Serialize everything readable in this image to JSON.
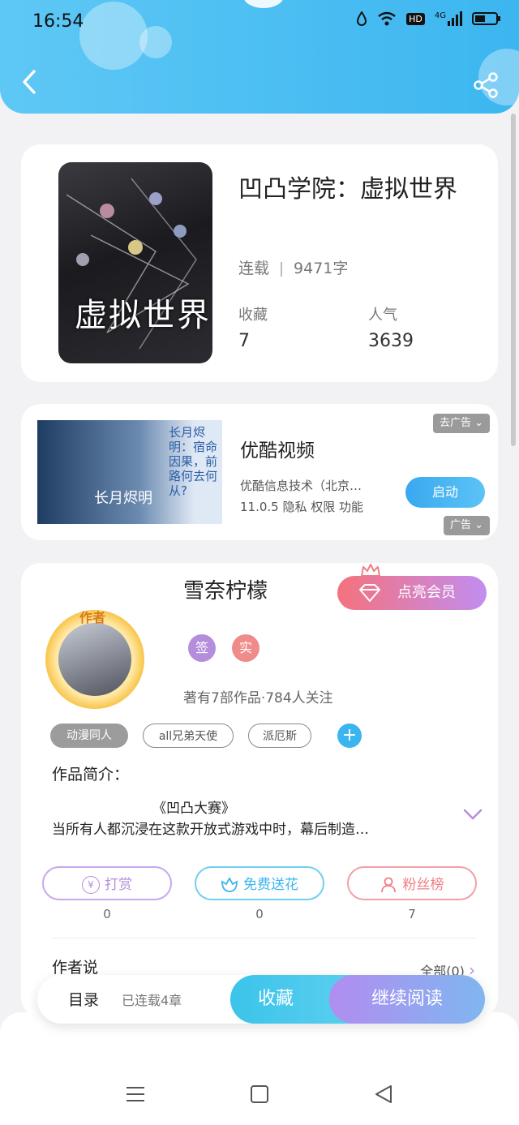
{
  "status_bar": {
    "time": "16:54",
    "icons": [
      "water-drop-icon",
      "wifi-icon",
      "hd-icon",
      "signal-4g-icon",
      "battery-icon"
    ],
    "hd": "HD",
    "network": "4G"
  },
  "header": {
    "back_icon": "chevron-left-icon",
    "share_icon": "share-icon",
    "color": "#48BDF2"
  },
  "book": {
    "cover_text": "虚拟世界",
    "title": "凹凸学院：虚拟世界",
    "status": "连载",
    "word_count": "9471字",
    "collect_label": "收藏",
    "collect_value": "7",
    "popularity_label": "人气",
    "popularity_value": "3639"
  },
  "ad": {
    "image_text": "长月烬明：宿命因果，前路何去何从?",
    "image_title": "长月烬明",
    "title": "优酷视频",
    "desc_line1": "优酷信息技术（北京…",
    "desc_line2": "11.0.5  隐私  权限  功能",
    "launch_button": "启动",
    "remove_ad": "去广告",
    "ad_label": "广告"
  },
  "author": {
    "name": "雪奈柠檬",
    "badge": "作者",
    "vip_button": "点亮会员",
    "sign_badge": "签",
    "real_badge": "实",
    "works": "著有7部作品·784人关注",
    "tags": [
      "动漫同人",
      "all兄弟天使",
      "派厄斯"
    ],
    "plus": "+"
  },
  "intro": {
    "label": "作品简介：",
    "subtitle": "《凹凸大赛》",
    "text": "当所有人都沉浸在这款开放式游戏中时，幕后制造…"
  },
  "actions": {
    "reward": "打赏",
    "reward_count": "0",
    "flowers": "免费送花",
    "flowers_count": "0",
    "fans": "粉丝榜",
    "fans_count": "7"
  },
  "author_say": {
    "label": "作者说",
    "all": "全部(0)"
  },
  "bottom_bar": {
    "toc": "目录",
    "chapters": "已连载4章",
    "collect": "收藏",
    "continue": "继续阅读"
  },
  "nav": {
    "menu_icon": "menu-icon",
    "home_icon": "home-square-icon",
    "back_icon": "back-triangle-icon"
  }
}
